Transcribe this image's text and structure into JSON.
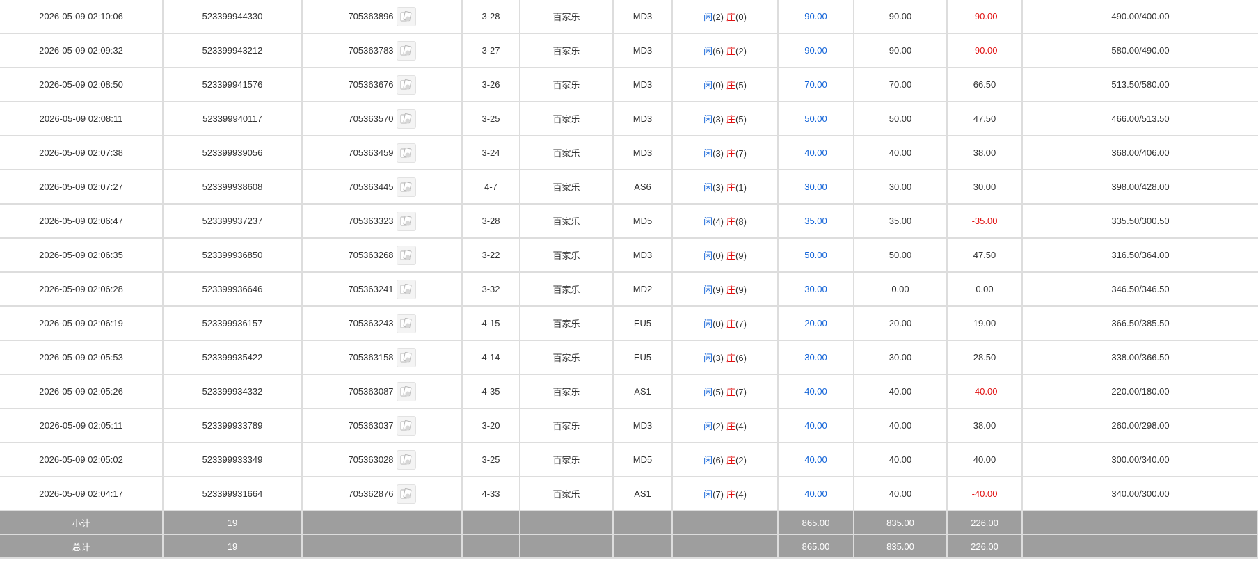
{
  "colors": {
    "player": "#1565d8",
    "banker": "#e01010",
    "summary_bg": "#9e9e9e",
    "grid": "#dddddd"
  },
  "icons": {
    "result_card": "playing-cards-icon"
  },
  "rows": [
    {
      "time": "2026-05-09 02:10:06",
      "bet_no": "523399944330",
      "round_no": "705363896",
      "shoe": "3-28",
      "game": "百家乐",
      "table": "MD3",
      "p_label": "闲",
      "p_val": "(2)",
      "b_label": "庄",
      "b_val": "(0)",
      "bet": "90.00",
      "valid": "90.00",
      "win": "-90.00",
      "win_neg": true,
      "balance": "490.00/400.00"
    },
    {
      "time": "2026-05-09 02:09:32",
      "bet_no": "523399943212",
      "round_no": "705363783",
      "shoe": "3-27",
      "game": "百家乐",
      "table": "MD3",
      "p_label": "闲",
      "p_val": "(6)",
      "b_label": "庄",
      "b_val": "(2)",
      "bet": "90.00",
      "valid": "90.00",
      "win": "-90.00",
      "win_neg": true,
      "balance": "580.00/490.00"
    },
    {
      "time": "2026-05-09 02:08:50",
      "bet_no": "523399941576",
      "round_no": "705363676",
      "shoe": "3-26",
      "game": "百家乐",
      "table": "MD3",
      "p_label": "闲",
      "p_val": "(0)",
      "b_label": "庄",
      "b_val": "(5)",
      "bet": "70.00",
      "valid": "70.00",
      "win": "66.50",
      "win_neg": false,
      "balance": "513.50/580.00"
    },
    {
      "time": "2026-05-09 02:08:11",
      "bet_no": "523399940117",
      "round_no": "705363570",
      "shoe": "3-25",
      "game": "百家乐",
      "table": "MD3",
      "p_label": "闲",
      "p_val": "(3)",
      "b_label": "庄",
      "b_val": "(5)",
      "bet": "50.00",
      "valid": "50.00",
      "win": "47.50",
      "win_neg": false,
      "balance": "466.00/513.50"
    },
    {
      "time": "2026-05-09 02:07:38",
      "bet_no": "523399939056",
      "round_no": "705363459",
      "shoe": "3-24",
      "game": "百家乐",
      "table": "MD3",
      "p_label": "闲",
      "p_val": "(3)",
      "b_label": "庄",
      "b_val": "(7)",
      "bet": "40.00",
      "valid": "40.00",
      "win": "38.00",
      "win_neg": false,
      "balance": "368.00/406.00"
    },
    {
      "time": "2026-05-09 02:07:27",
      "bet_no": "523399938608",
      "round_no": "705363445",
      "shoe": "4-7",
      "game": "百家乐",
      "table": "AS6",
      "p_label": "闲",
      "p_val": "(3)",
      "b_label": "庄",
      "b_val": "(1)",
      "bet": "30.00",
      "valid": "30.00",
      "win": "30.00",
      "win_neg": false,
      "balance": "398.00/428.00"
    },
    {
      "time": "2026-05-09 02:06:47",
      "bet_no": "523399937237",
      "round_no": "705363323",
      "shoe": "3-28",
      "game": "百家乐",
      "table": "MD5",
      "p_label": "闲",
      "p_val": "(4)",
      "b_label": "庄",
      "b_val": "(8)",
      "bet": "35.00",
      "valid": "35.00",
      "win": "-35.00",
      "win_neg": true,
      "balance": "335.50/300.50"
    },
    {
      "time": "2026-05-09 02:06:35",
      "bet_no": "523399936850",
      "round_no": "705363268",
      "shoe": "3-22",
      "game": "百家乐",
      "table": "MD3",
      "p_label": "闲",
      "p_val": "(0)",
      "b_label": "庄",
      "b_val": "(9)",
      "bet": "50.00",
      "valid": "50.00",
      "win": "47.50",
      "win_neg": false,
      "balance": "316.50/364.00"
    },
    {
      "time": "2026-05-09 02:06:28",
      "bet_no": "523399936646",
      "round_no": "705363241",
      "shoe": "3-32",
      "game": "百家乐",
      "table": "MD2",
      "p_label": "闲",
      "p_val": "(9)",
      "b_label": "庄",
      "b_val": "(9)",
      "bet": "30.00",
      "valid": "0.00",
      "win": "0.00",
      "win_neg": false,
      "balance": "346.50/346.50"
    },
    {
      "time": "2026-05-09 02:06:19",
      "bet_no": "523399936157",
      "round_no": "705363243",
      "shoe": "4-15",
      "game": "百家乐",
      "table": "EU5",
      "p_label": "闲",
      "p_val": "(0)",
      "b_label": "庄",
      "b_val": "(7)",
      "bet": "20.00",
      "valid": "20.00",
      "win": "19.00",
      "win_neg": false,
      "balance": "366.50/385.50"
    },
    {
      "time": "2026-05-09 02:05:53",
      "bet_no": "523399935422",
      "round_no": "705363158",
      "shoe": "4-14",
      "game": "百家乐",
      "table": "EU5",
      "p_label": "闲",
      "p_val": "(3)",
      "b_label": "庄",
      "b_val": "(6)",
      "bet": "30.00",
      "valid": "30.00",
      "win": "28.50",
      "win_neg": false,
      "balance": "338.00/366.50"
    },
    {
      "time": "2026-05-09 02:05:26",
      "bet_no": "523399934332",
      "round_no": "705363087",
      "shoe": "4-35",
      "game": "百家乐",
      "table": "AS1",
      "p_label": "闲",
      "p_val": "(5)",
      "b_label": "庄",
      "b_val": "(7)",
      "bet": "40.00",
      "valid": "40.00",
      "win": "-40.00",
      "win_neg": true,
      "balance": "220.00/180.00"
    },
    {
      "time": "2026-05-09 02:05:11",
      "bet_no": "523399933789",
      "round_no": "705363037",
      "shoe": "3-20",
      "game": "百家乐",
      "table": "MD3",
      "p_label": "闲",
      "p_val": "(2)",
      "b_label": "庄",
      "b_val": "(4)",
      "bet": "40.00",
      "valid": "40.00",
      "win": "38.00",
      "win_neg": false,
      "balance": "260.00/298.00"
    },
    {
      "time": "2026-05-09 02:05:02",
      "bet_no": "523399933349",
      "round_no": "705363028",
      "shoe": "3-25",
      "game": "百家乐",
      "table": "MD5",
      "p_label": "闲",
      "p_val": "(6)",
      "b_label": "庄",
      "b_val": "(2)",
      "bet": "40.00",
      "valid": "40.00",
      "win": "40.00",
      "win_neg": false,
      "balance": "300.00/340.00"
    },
    {
      "time": "2026-05-09 02:04:17",
      "bet_no": "523399931664",
      "round_no": "705362876",
      "shoe": "4-33",
      "game": "百家乐",
      "table": "AS1",
      "p_label": "闲",
      "p_val": "(7)",
      "b_label": "庄",
      "b_val": "(4)",
      "bet": "40.00",
      "valid": "40.00",
      "win": "-40.00",
      "win_neg": true,
      "balance": "340.00/300.00"
    }
  ],
  "subtotal": {
    "label": "小计",
    "count": "19",
    "bet": "865.00",
    "valid": "835.00",
    "win": "226.00"
  },
  "total": {
    "label": "总计",
    "count": "19",
    "bet": "865.00",
    "valid": "835.00",
    "win": "226.00"
  }
}
